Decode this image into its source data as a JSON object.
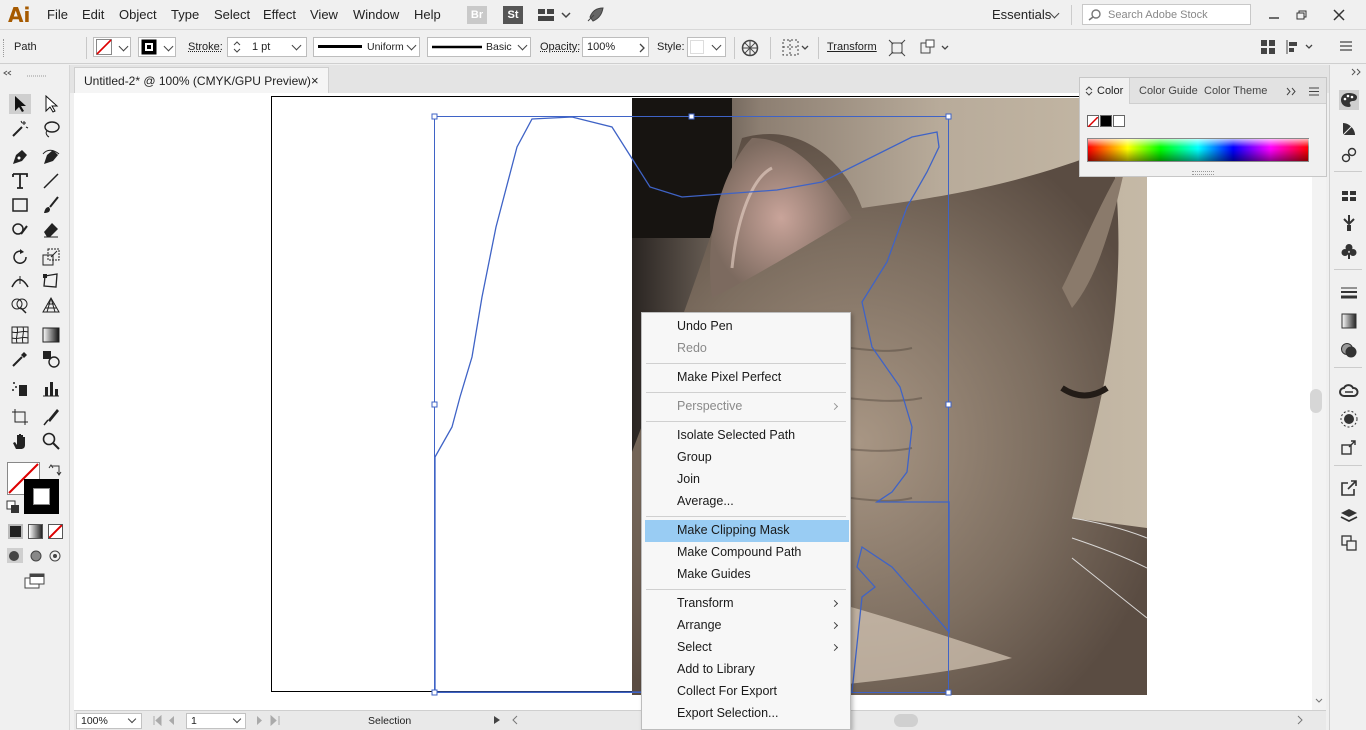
{
  "app": {
    "logo": "Ai",
    "menu": [
      "File",
      "Edit",
      "Object",
      "Type",
      "Select",
      "Effect",
      "View",
      "Window",
      "Help"
    ],
    "bridge_badge": "Br",
    "stock_badge": "St"
  },
  "workspace": {
    "label": "Essentials",
    "search_placeholder": "Search Adobe Stock"
  },
  "control": {
    "selection_type": "Path",
    "stroke_label": "Stroke:",
    "stroke_weight": "1 pt",
    "profile": "Uniform",
    "brush": "Basic",
    "opacity_label": "Opacity:",
    "opacity": "100%",
    "style_label": "Style:",
    "transform_label": "Transform"
  },
  "document": {
    "tab_title": "Untitled-2* @ 100% (CMYK/GPU Preview)",
    "close": "×"
  },
  "color_panel": {
    "tabs": [
      "Color",
      "Color Guide",
      "Color Theme"
    ]
  },
  "status": {
    "zoom": "100%",
    "artboard": "1",
    "tool": "Selection"
  },
  "context_menu": [
    {
      "label": "Undo Pen"
    },
    {
      "label": "Redo",
      "disabled": true
    },
    {
      "label": "Make Pixel Perfect"
    },
    {
      "label": "Perspective",
      "disabled": true,
      "submenu": true
    },
    {
      "label": "Isolate Selected Path"
    },
    {
      "label": "Group"
    },
    {
      "label": "Join"
    },
    {
      "label": "Average..."
    },
    {
      "label": "Make Clipping Mask",
      "highlighted": true
    },
    {
      "label": "Make Compound Path"
    },
    {
      "label": "Make Guides"
    },
    {
      "label": "Transform",
      "submenu": true
    },
    {
      "label": "Arrange",
      "submenu": true
    },
    {
      "label": "Select",
      "submenu": true
    },
    {
      "label": "Add to Library"
    },
    {
      "label": "Collect For Export"
    },
    {
      "label": "Export Selection..."
    }
  ],
  "colors": {
    "selection": "#3f63c6",
    "highlight": "#99ccf3",
    "logo": "#a65a00"
  }
}
